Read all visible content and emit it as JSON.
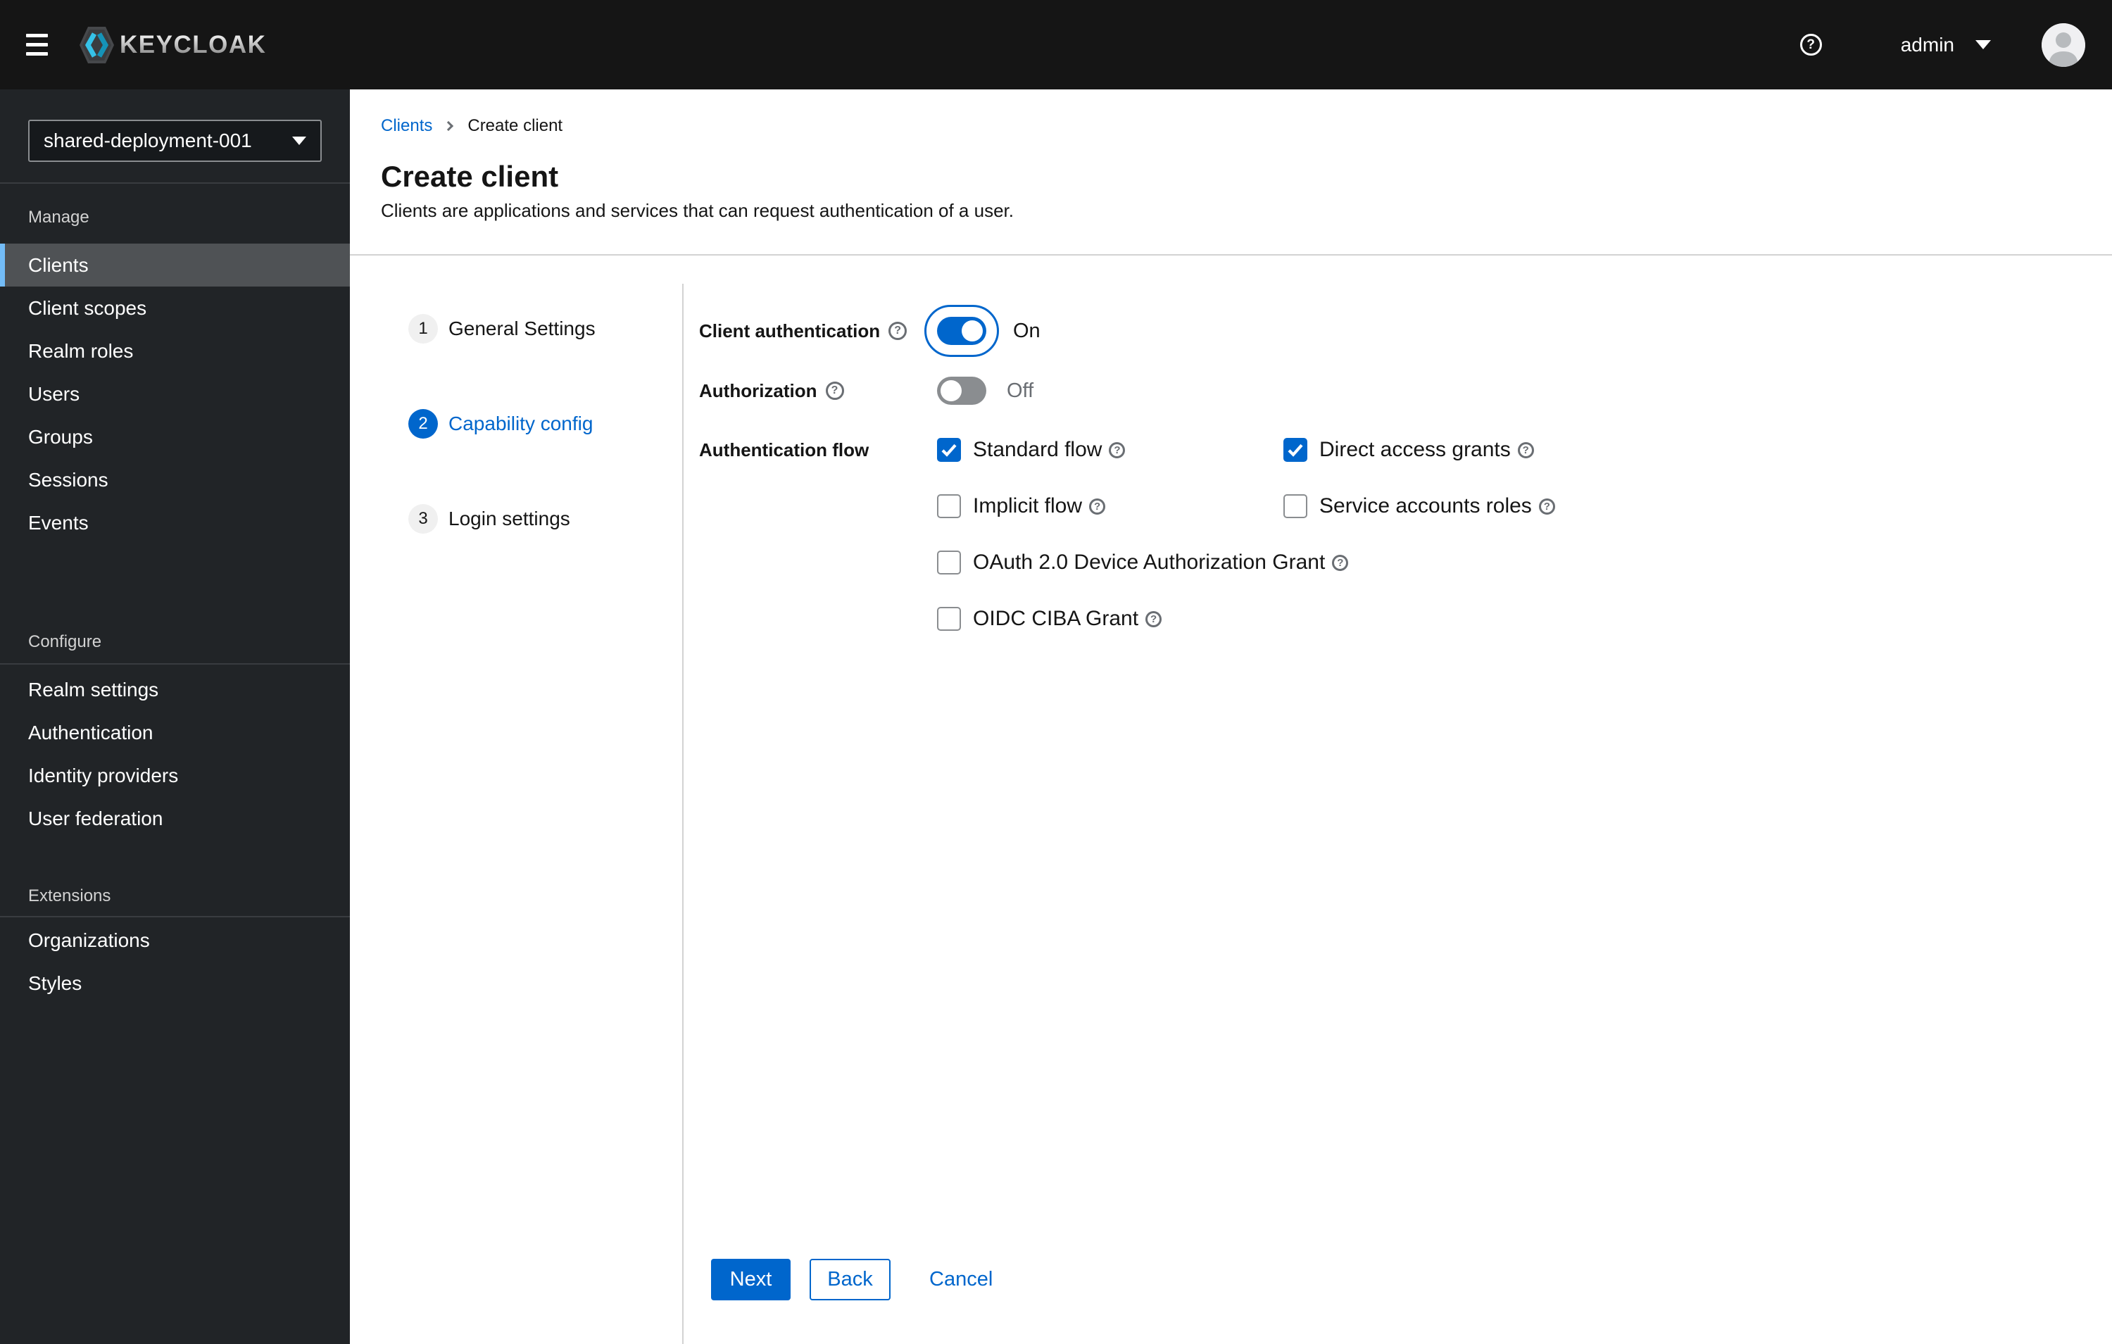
{
  "topbar": {
    "brand": "KEYCLOAK",
    "username": "admin"
  },
  "icons": {
    "question_mark": "?"
  },
  "sidebar": {
    "realm_selector": {
      "value": "shared-deployment-001"
    },
    "sections": [
      {
        "label": "Manage",
        "active_item": "Clients",
        "items": [
          "Clients",
          "Client scopes",
          "Realm roles",
          "Users",
          "Groups",
          "Sessions",
          "Events"
        ]
      },
      {
        "label": "Configure",
        "items": [
          "Realm settings",
          "Authentication",
          "Identity providers",
          "User federation"
        ]
      },
      {
        "label": "Extensions",
        "items": [
          "Organizations",
          "Styles"
        ]
      }
    ]
  },
  "breadcrumb": {
    "items": [
      "Clients",
      "Create client"
    ]
  },
  "page": {
    "title": "Create client",
    "description": "Clients are applications and services that can request authentication of a user."
  },
  "wizard": {
    "steps": [
      {
        "number": "1",
        "label": "General Settings",
        "current": false
      },
      {
        "number": "2",
        "label": "Capability config",
        "current": true
      },
      {
        "number": "3",
        "label": "Login settings",
        "current": false
      }
    ]
  },
  "form": {
    "client_auth": {
      "label": "Client authentication",
      "on": true,
      "state_label": "On"
    },
    "authorization": {
      "label": "Authorization",
      "on": false,
      "state_label": "Off"
    },
    "auth_flow": {
      "label": "Authentication flow",
      "checkboxes": [
        {
          "label": "Standard flow",
          "checked": true
        },
        {
          "label": "Direct access grants",
          "checked": true
        },
        {
          "label": "Implicit flow",
          "checked": false
        },
        {
          "label": "Service accounts roles",
          "checked": false
        },
        {
          "label": "OAuth 2.0 Device Authorization Grant",
          "checked": false
        },
        {
          "label": "OIDC CIBA Grant",
          "checked": false
        }
      ]
    }
  },
  "actions": {
    "next": "Next",
    "back": "Back",
    "cancel": "Cancel"
  },
  "colors": {
    "primary_blue": "#0066cc",
    "nav_active_accent": "#73bcf7",
    "nav_active_bg": "#4f5255",
    "topbar_bg": "#151515",
    "sidebar_bg": "#212427",
    "divider": "#d2d2d2",
    "muted_text": "#6a6e73",
    "switch_off": "#8a8d90"
  }
}
